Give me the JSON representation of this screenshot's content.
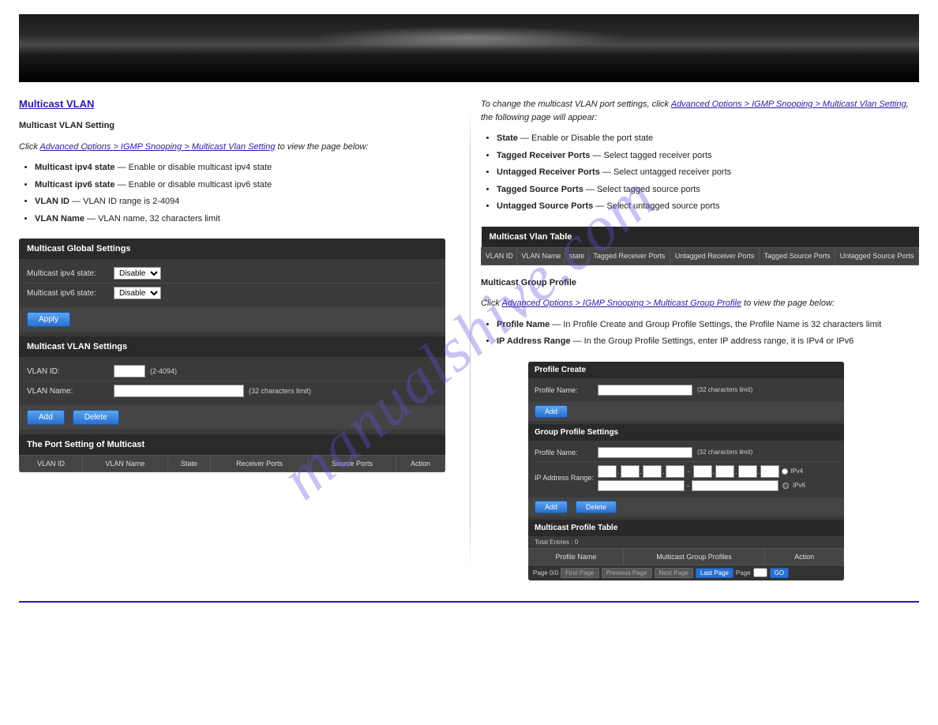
{
  "watermark": "manualshive.com",
  "left": {
    "section_title": "Multicast VLAN",
    "vlan_setting": {
      "heading": "Multicast VLAN Setting",
      "intro_prefix": "Click ",
      "nav_path": "Advanced Options > IGMP Snooping > Multicast Vlan Setting",
      "intro_suffix": " to view the page below:",
      "fields": [
        {
          "name": "Multicast ipv4 state",
          "desc": "Enable or disable multicast ipv4 state"
        },
        {
          "name": "Multicast ipv6 state",
          "desc": "Enable or disable multicast ipv6 state"
        },
        {
          "name": "VLAN ID",
          "desc": "VLAN ID range is 2-4094"
        },
        {
          "name": "VLAN Name",
          "desc": "VLAN name, 32 characters limit"
        }
      ]
    },
    "panel_global": {
      "title": "Multicast Global Settings",
      "row1_label": "Multicast ipv4 state:",
      "row2_label": "Multicast ipv6 state:",
      "state_value": "Disabled",
      "apply": "Apply"
    },
    "panel_vlan": {
      "title": "Multicast VLAN Settings",
      "vlan_id_label": "VLAN ID:",
      "vlan_id_hint": "(2-4094)",
      "vlan_name_label": "VLAN Name:",
      "vlan_name_hint": "(32 characters limit)",
      "add": "Add",
      "delete": "Delete"
    },
    "panel_port": {
      "title": "The Port Setting of Multicast",
      "cols": [
        "VLAN ID",
        "VLAN Name",
        "State",
        "Receiver Ports",
        "Source Ports",
        "Action"
      ]
    }
  },
  "right": {
    "upper": {
      "intro_prefix": "To change the multicast VLAN port settings, click ",
      "nav_path": "Advanced Options > IGMP Snooping > Multicast Vlan Setting",
      "intro_suffix": ", the following page will appear:",
      "fields": [
        {
          "name": "State",
          "desc": "Enable or Disable the port state"
        },
        {
          "name": "Tagged Receiver Ports",
          "desc": "Select tagged receiver ports"
        },
        {
          "name": "Untagged Receiver Ports",
          "desc": "Select untagged receiver ports"
        },
        {
          "name": "Tagged Source Ports",
          "desc": "Select tagged source ports"
        },
        {
          "name": "Untagged Source Ports",
          "desc": "Select untagged source ports"
        }
      ],
      "table": {
        "title": "Multicast Vlan Table",
        "cols": [
          "VLAN ID",
          "VLAN Name",
          "state",
          "Tagged Receiver Ports",
          "Untagged Receiver Ports",
          "Tagged Source Ports",
          "Untagged Source Ports"
        ]
      }
    },
    "profile": {
      "heading": "Multicast Group Profile",
      "intro_prefix": "Click ",
      "nav_path": "Advanced Options > IGMP Snooping > Multicast Group Profile",
      "intro_suffix": " to view the page below:",
      "fields": [
        {
          "name": "Profile Name",
          "desc": "In Profile Create and Group Profile Settings, the Profile Name is 32 characters limit"
        },
        {
          "name": "IP Address Range",
          "desc": "In the Group Profile Settings, enter IP address range, it is IPv4 or IPv6"
        }
      ],
      "panel_create": {
        "title": "Profile Create",
        "name_label": "Profile Name:",
        "hint": "(32 characters limit)",
        "add": "Add"
      },
      "panel_group": {
        "title": "Group Profile Settings",
        "name_label": "Profile Name:",
        "name_hint": "(32 characters limit)",
        "ip_label": "IP Address Range:",
        "ipv4": "IPv4",
        "ipv6": "IPv6",
        "add": "Add",
        "delete": "Delete"
      },
      "panel_table": {
        "title": "Multicast Profile Table",
        "total": "Total Entries : 0",
        "cols": [
          "Profile Name",
          "Multicast Group Profiles",
          "Action"
        ],
        "pager": {
          "page_of": "Page 0/0",
          "first": "First Page",
          "prev": "Previous Page",
          "next": "Next Page",
          "last": "Last Page",
          "page_label": "Page",
          "go": "GO"
        }
      }
    }
  }
}
